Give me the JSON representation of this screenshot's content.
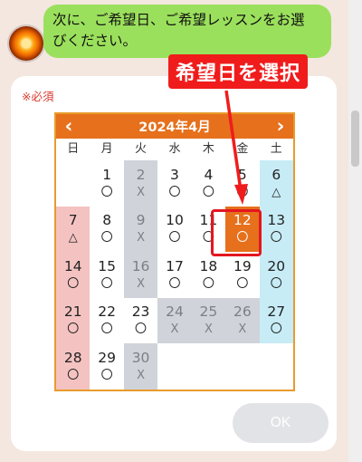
{
  "chat": {
    "message_line1": "次に、ご希望日、ご希望レッスンをお選",
    "message_line2": "びください。"
  },
  "form": {
    "required_label": "※必須",
    "ok_label": "OK"
  },
  "annotation": {
    "text": "希望日を選択"
  },
  "calendar": {
    "title": "2024年4月",
    "prev": "‹",
    "next": "›",
    "weekdays": [
      "日",
      "月",
      "火",
      "水",
      "木",
      "金",
      "土"
    ],
    "cells": [
      {
        "day": "",
        "mark": "",
        "type": "empty"
      },
      {
        "day": "1",
        "mark": "〇",
        "type": "normal"
      },
      {
        "day": "2",
        "mark": "X",
        "type": "closed"
      },
      {
        "day": "3",
        "mark": "〇",
        "type": "normal"
      },
      {
        "day": "4",
        "mark": "〇",
        "type": "normal"
      },
      {
        "day": "5",
        "mark": "〇",
        "type": "normal"
      },
      {
        "day": "6",
        "mark": "△",
        "type": "sat"
      },
      {
        "day": "7",
        "mark": "△",
        "type": "sun"
      },
      {
        "day": "8",
        "mark": "〇",
        "type": "normal"
      },
      {
        "day": "9",
        "mark": "X",
        "type": "closed"
      },
      {
        "day": "10",
        "mark": "〇",
        "type": "normal"
      },
      {
        "day": "11",
        "mark": "〇",
        "type": "normal"
      },
      {
        "day": "12",
        "mark": "〇",
        "type": "selected"
      },
      {
        "day": "13",
        "mark": "〇",
        "type": "sat"
      },
      {
        "day": "14",
        "mark": "〇",
        "type": "sun"
      },
      {
        "day": "15",
        "mark": "〇",
        "type": "normal"
      },
      {
        "day": "16",
        "mark": "X",
        "type": "closed"
      },
      {
        "day": "17",
        "mark": "〇",
        "type": "normal"
      },
      {
        "day": "18",
        "mark": "〇",
        "type": "normal"
      },
      {
        "day": "19",
        "mark": "〇",
        "type": "normal"
      },
      {
        "day": "20",
        "mark": "〇",
        "type": "sat"
      },
      {
        "day": "21",
        "mark": "〇",
        "type": "sun"
      },
      {
        "day": "22",
        "mark": "〇",
        "type": "normal"
      },
      {
        "day": "23",
        "mark": "〇",
        "type": "normal"
      },
      {
        "day": "24",
        "mark": "X",
        "type": "closed"
      },
      {
        "day": "25",
        "mark": "X",
        "type": "closed"
      },
      {
        "day": "26",
        "mark": "X",
        "type": "closed"
      },
      {
        "day": "27",
        "mark": "〇",
        "type": "sat"
      },
      {
        "day": "28",
        "mark": "〇",
        "type": "sun"
      },
      {
        "day": "29",
        "mark": "〇",
        "type": "normal"
      },
      {
        "day": "30",
        "mark": "X",
        "type": "closed"
      },
      {
        "day": "",
        "mark": "",
        "type": "empty"
      },
      {
        "day": "",
        "mark": "",
        "type": "empty"
      },
      {
        "day": "",
        "mark": "",
        "type": "empty"
      },
      {
        "day": "",
        "mark": "",
        "type": "empty"
      }
    ]
  },
  "colors": {
    "header": "#e6701c",
    "sunday": "#f4c3c1",
    "saturday": "#c7ecf6",
    "closed": "#d0d3d9",
    "highlight": "#e4161f",
    "bubble": "#9be05c"
  },
  "icons": {
    "avatar": "sun-avatar-icon",
    "arrow": "pointer-arrow-icon"
  }
}
